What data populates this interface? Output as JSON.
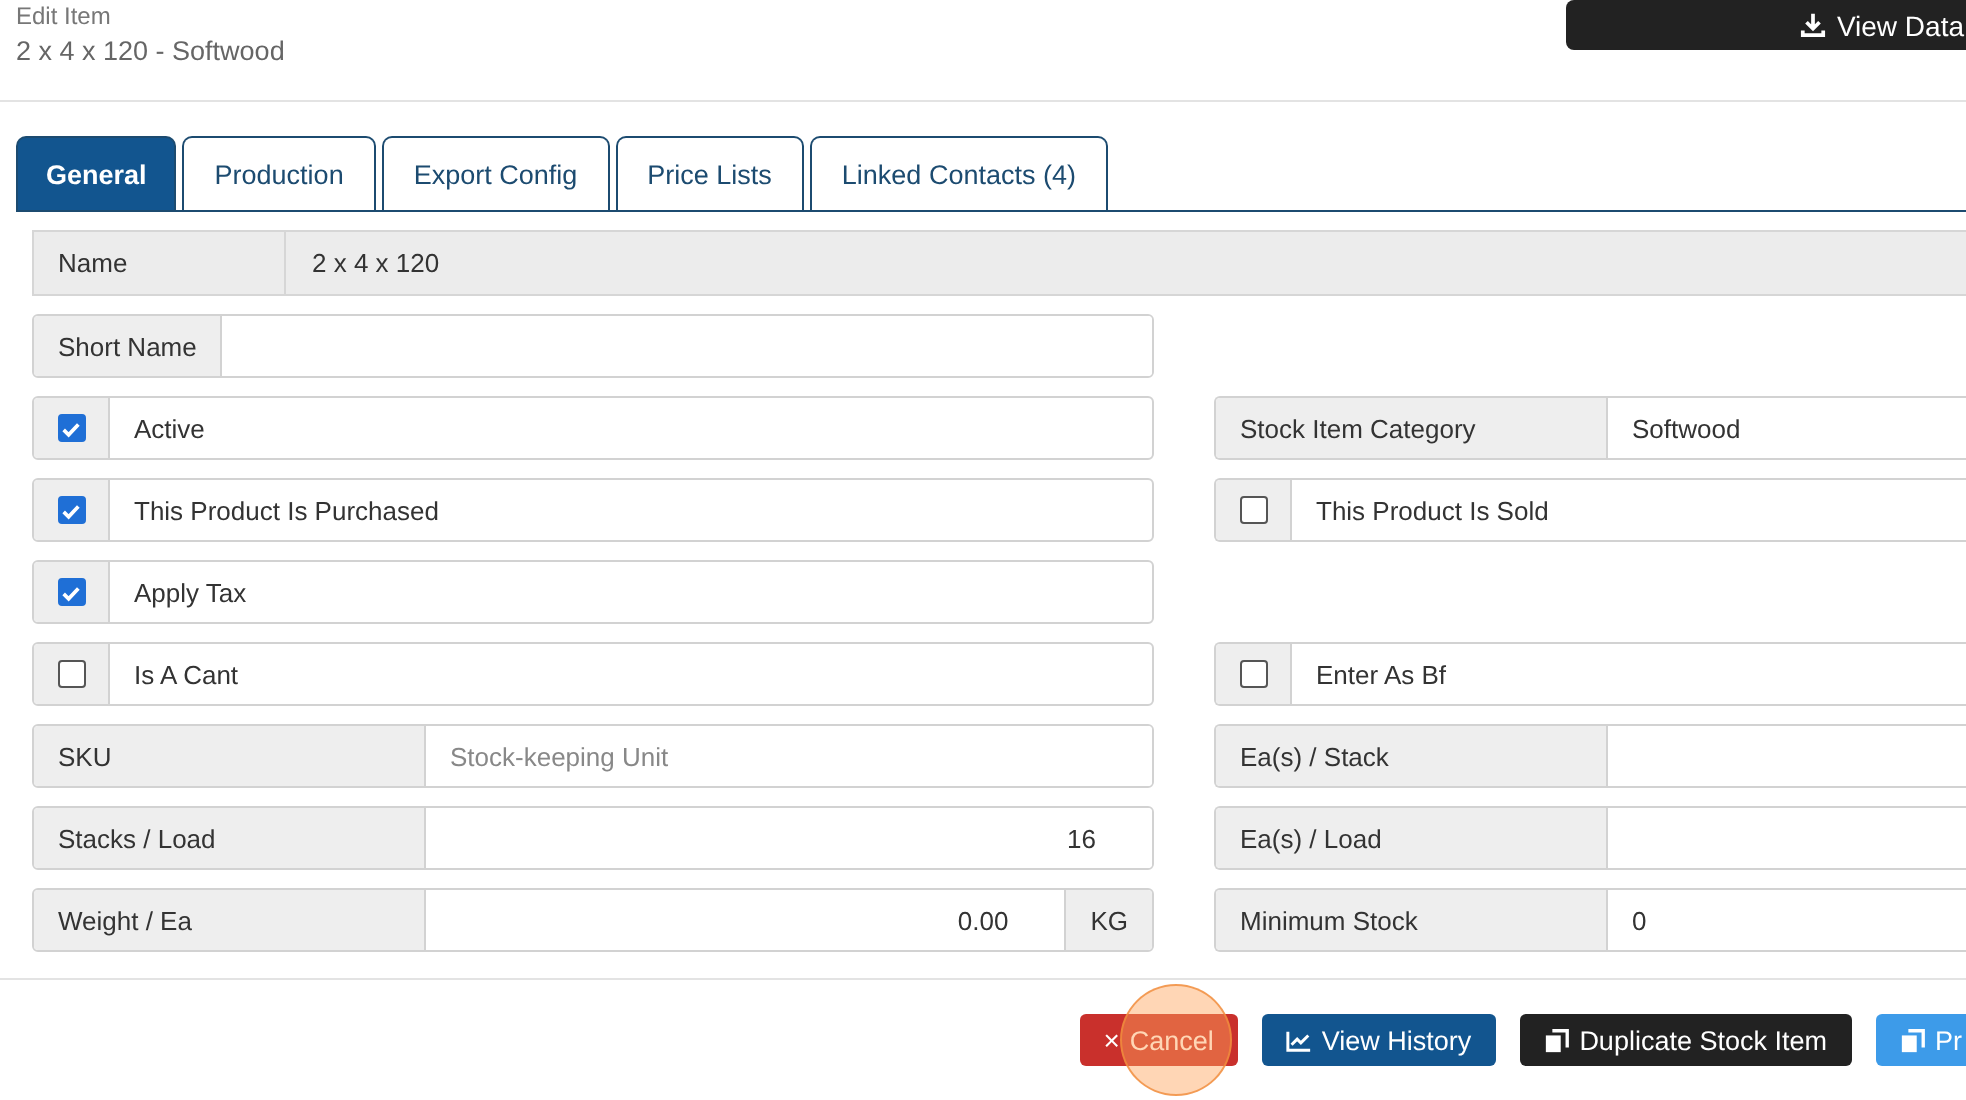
{
  "header": {
    "caption": "Edit Item",
    "title": "2 x 4 x 120 - Softwood",
    "action": {
      "label": "View Data"
    }
  },
  "tabs": [
    {
      "label": "General",
      "selected": true
    },
    {
      "label": "Production",
      "selected": false
    },
    {
      "label": "Export Config",
      "selected": false
    },
    {
      "label": "Price Lists",
      "selected": false
    },
    {
      "label": "Linked Contacts (4)",
      "selected": false
    }
  ],
  "name_field": {
    "label": "Name",
    "value": "2 x 4 x 120"
  },
  "rows": [
    {
      "left": {
        "kind": "auto",
        "label": "Short Name"
      },
      "right": null
    },
    {
      "left": {
        "kind": "check",
        "label": "Active",
        "checked": true
      },
      "right": {
        "kind": "field",
        "label": "Stock Item Category",
        "value": "Softwood"
      }
    },
    {
      "left": {
        "kind": "check",
        "label": "This Product Is Purchased",
        "checked": true
      },
      "right": {
        "kind": "check",
        "label": "This Product Is Sold",
        "checked": false
      }
    },
    {
      "left": {
        "kind": "check",
        "label": "Apply Tax",
        "checked": true
      },
      "right": null
    },
    {
      "left": {
        "kind": "check",
        "label": "Is A Cant",
        "checked": false
      },
      "right": {
        "kind": "check",
        "label": "Enter As Bf",
        "checked": false
      }
    },
    {
      "left": {
        "kind": "field",
        "label": "SKU",
        "placeholder": "Stock-keeping Unit"
      },
      "right": {
        "kind": "field",
        "label": "Ea(s) / Stack"
      }
    },
    {
      "left": {
        "kind": "number",
        "label": "Stacks / Load",
        "value": "16"
      },
      "right": {
        "kind": "field",
        "label": "Ea(s) / Load"
      }
    },
    {
      "left": {
        "kind": "number",
        "label": "Weight / Ea",
        "value": "0.00",
        "unit": "KG"
      },
      "right": {
        "kind": "field",
        "label": "Minimum Stock",
        "value": "0"
      }
    }
  ],
  "buttons": [
    {
      "label": "Cancel",
      "kind": "danger",
      "glyph": "×",
      "pressed": true
    },
    {
      "label": "View History",
      "kind": "primary",
      "pressed": false
    },
    {
      "label": "Duplicate Stock Item",
      "kind": "dark",
      "pressed": false
    },
    {
      "label": "Pr",
      "kind": "info",
      "pressed": false
    }
  ]
}
